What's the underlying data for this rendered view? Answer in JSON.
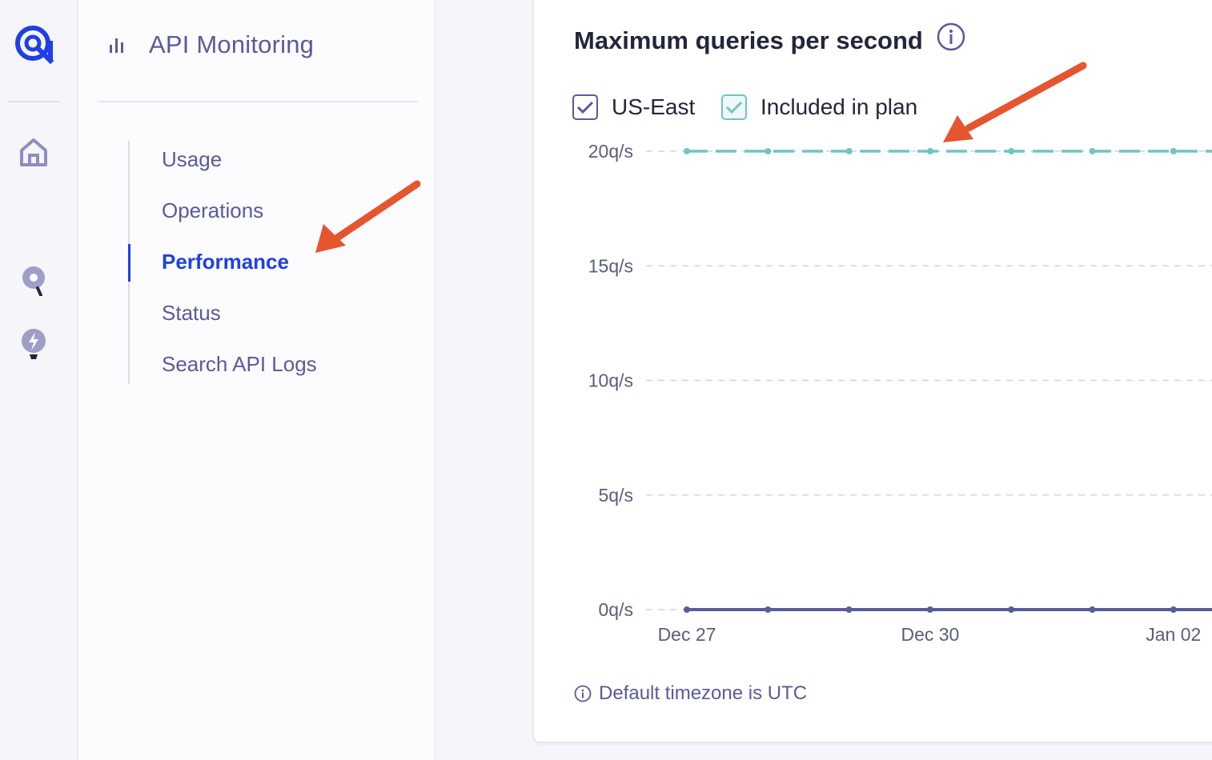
{
  "rail": {
    "items": [
      {
        "icon": "home-icon"
      },
      {
        "icon": "search-pin-icon"
      },
      {
        "icon": "bolt-bulb-icon"
      }
    ]
  },
  "nav": {
    "title": "API Monitoring",
    "title_icon": "bar-chart-icon",
    "items": [
      {
        "label": "Usage"
      },
      {
        "label": "Operations"
      },
      {
        "label": "Performance",
        "active": true
      },
      {
        "label": "Status"
      },
      {
        "label": "Search API Logs"
      }
    ]
  },
  "chart": {
    "title": "Maximum queries per second",
    "info_icon": "info-icon",
    "legend": [
      {
        "label": "US-East",
        "color": "#5a5a9c",
        "checked": true
      },
      {
        "label": "Included in plan",
        "color": "#6ec5c1",
        "checked": true
      }
    ],
    "timezone_note": "Default timezone is UTC"
  },
  "colors": {
    "accent": "#1f3fe5",
    "nav_text": "#5a5a9c",
    "series_us_east": "#5a5a9c",
    "series_plan": "#6ec5c1",
    "annotation_arrow": "#e5552e"
  },
  "chart_data": {
    "type": "line",
    "title": "Maximum queries per second",
    "xlabel": "",
    "ylabel": "",
    "y_ticks": [
      "0q/s",
      "5q/s",
      "10q/s",
      "15q/s",
      "20q/s"
    ],
    "y_tick_values": [
      0,
      5,
      10,
      15,
      20
    ],
    "ylim": [
      0,
      20
    ],
    "x_ticks": [
      "Dec 27",
      "Dec 30",
      "Jan 02"
    ],
    "x": [
      "Dec 27",
      "Dec 28",
      "Dec 29",
      "Dec 30",
      "Dec 31",
      "Jan 01",
      "Jan 02"
    ],
    "grid": true,
    "legend_placement": "top-left",
    "series": [
      {
        "name": "US-East",
        "values": [
          0,
          0,
          0,
          0,
          0,
          0,
          0
        ],
        "color": "#5a5a9c",
        "style": "solid"
      },
      {
        "name": "Included in plan",
        "values": [
          20,
          20,
          20,
          20,
          20,
          20,
          20
        ],
        "color": "#6ec5c1",
        "style": "dashed"
      }
    ]
  }
}
